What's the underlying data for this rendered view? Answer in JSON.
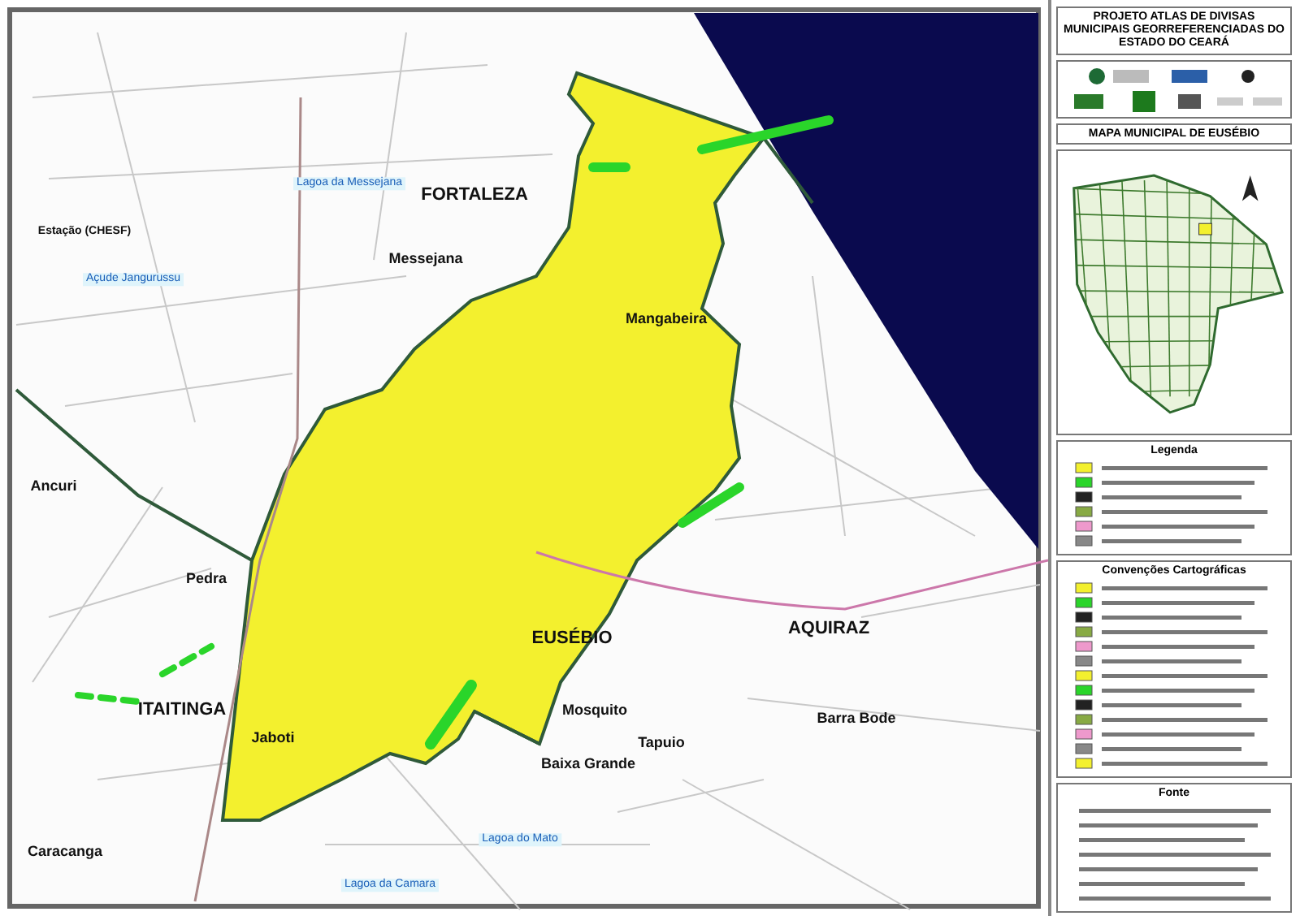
{
  "header": {
    "title": "PROJETO ATLAS DE DIVISAS MUNICIPAIS GEORREFERENCIADAS DO ESTADO DO CEARÁ",
    "map_title": "MAPA MUNICIPAL DE EUSÉBIO"
  },
  "map": {
    "places": [
      {
        "label": "FORTALEZA",
        "kind": "municipality"
      },
      {
        "label": "Messejana",
        "kind": "locality"
      },
      {
        "label": "Mangabeira",
        "kind": "locality"
      },
      {
        "label": "EUSÉBIO",
        "kind": "municipality"
      },
      {
        "label": "AQUIRAZ",
        "kind": "municipality"
      },
      {
        "label": "ITAITINGA",
        "kind": "municipality"
      },
      {
        "label": "Ancuri",
        "kind": "locality"
      },
      {
        "label": "Pedra",
        "kind": "locality"
      },
      {
        "label": "Jaboti",
        "kind": "locality"
      },
      {
        "label": "Caracanga",
        "kind": "locality"
      },
      {
        "label": "Mosquito",
        "kind": "locality"
      },
      {
        "label": "Baixa Grande",
        "kind": "locality"
      },
      {
        "label": "Tapuio",
        "kind": "locality"
      },
      {
        "label": "Barra Bode",
        "kind": "locality"
      },
      {
        "label": "Estação (CHESF)",
        "kind": "feature"
      },
      {
        "label": "Lagoa da Messejana",
        "kind": "water"
      },
      {
        "label": "Açude Jangurussu",
        "kind": "water"
      },
      {
        "label": "Lagoa do Mato",
        "kind": "water"
      },
      {
        "label": "Lagoa da Camara",
        "kind": "water"
      }
    ]
  },
  "legend": {
    "title": "Legenda"
  },
  "conventions": {
    "title": "Convenções Cartográficas"
  },
  "source": {
    "title": "Fonte"
  }
}
